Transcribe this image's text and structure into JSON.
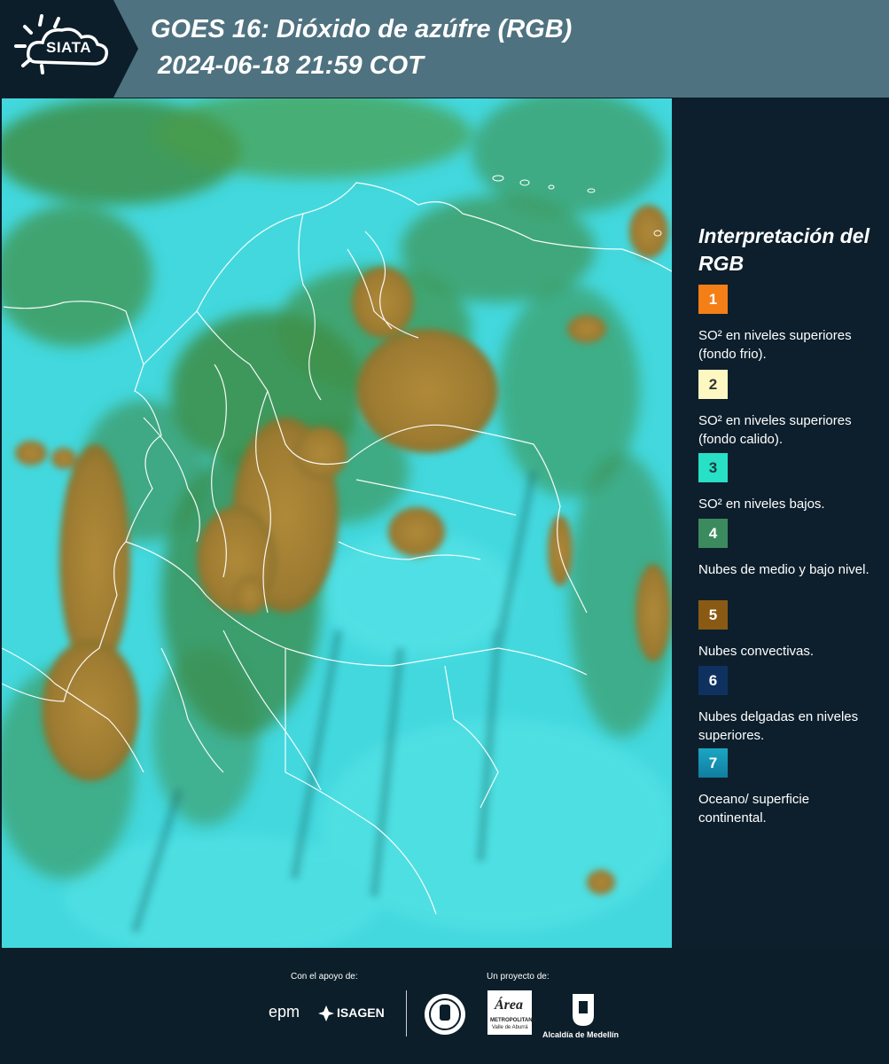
{
  "header": {
    "logo_text": "SIATA",
    "title_line1": "GOES 16: Dióxido de azúfre (RGB)",
    "title_line2": "2024-06-18 21:59 COT"
  },
  "map": {
    "colors": {
      "background": "#3fd6dd",
      "convective": "#a37b2c",
      "mid_low": "#3c8e4a",
      "borders": "#ffffff"
    }
  },
  "legend": {
    "title": "Interpretación del RGB",
    "items": [
      {
        "number": "1",
        "label": "SO² en niveles superiores (fondo frio).",
        "color": "#f47f16"
      },
      {
        "number": "2",
        "label": "SO² en niveles superiores (fondo calido).",
        "color": "#fdf7c2"
      },
      {
        "number": "3",
        "label": "SO² en niveles bajos.",
        "color": "#27e0c5"
      },
      {
        "number": "4",
        "label": "Nubes de medio y bajo nivel.",
        "color": "#3b8b5f"
      },
      {
        "number": "5",
        "label": "Nubes convectivas.",
        "color": "#8a5a14"
      },
      {
        "number": "6",
        "label": "Nubes delgadas en niveles superiores.",
        "color": "#0e3160"
      },
      {
        "number": "7",
        "label": "Oceano/ superficie continental.",
        "color": "#1a8fb0"
      }
    ]
  },
  "footer": {
    "support_caption": "Con el apoyo de:",
    "project_caption": "Un proyecto de:",
    "epm": "epm",
    "isagen": "ISAGEN",
    "area_metro": "Área",
    "area_metro_sub": "METROPOLITANA",
    "area_metro_sub2": "Valle de Aburrá",
    "alcaldia": "Alcaldía de Medellín"
  }
}
